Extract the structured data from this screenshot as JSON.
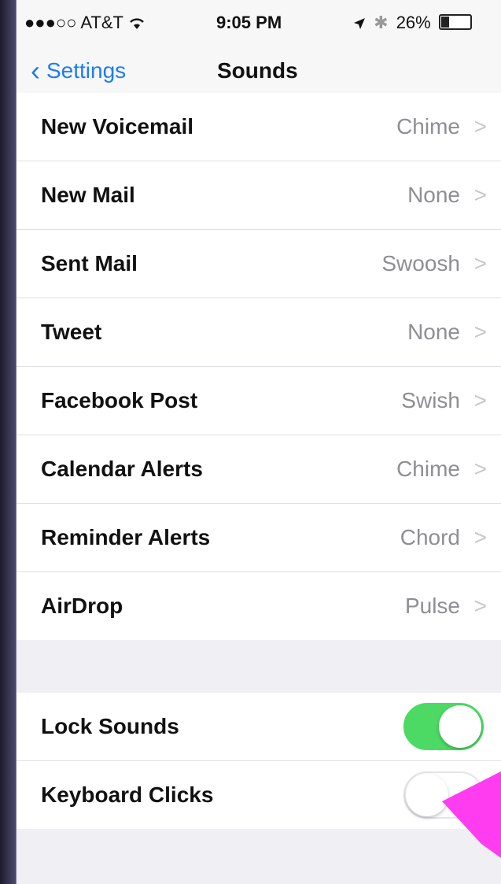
{
  "status_bar": {
    "carrier": "●●●○○ AT&T",
    "wifi_icon": "wifi-icon",
    "time": "9:05 PM",
    "location_icon": "location-arrow-icon",
    "bluetooth_icon": "bluetooth-icon",
    "battery": "26%",
    "battery_level": 0.26
  },
  "nav": {
    "back_label": "Settings",
    "title": "Sounds"
  },
  "sounds": [
    {
      "label": "New Voicemail",
      "value": "Chime"
    },
    {
      "label": "New Mail",
      "value": "None"
    },
    {
      "label": "Sent Mail",
      "value": "Swoosh"
    },
    {
      "label": "Tweet",
      "value": "None"
    },
    {
      "label": "Facebook Post",
      "value": "Swish"
    },
    {
      "label": "Calendar Alerts",
      "value": "Chime"
    },
    {
      "label": "Reminder Alerts",
      "value": "Chord"
    },
    {
      "label": "AirDrop",
      "value": "Pulse"
    }
  ],
  "toggles": [
    {
      "label": "Lock Sounds",
      "state": "on"
    },
    {
      "label": "Keyboard Clicks",
      "state": "off"
    }
  ],
  "colors": {
    "accent": "#1e7cf2",
    "toggle_on": "#4cd964",
    "annotation_arrow": "#ff3cf0"
  },
  "chevron_glyph": ">"
}
